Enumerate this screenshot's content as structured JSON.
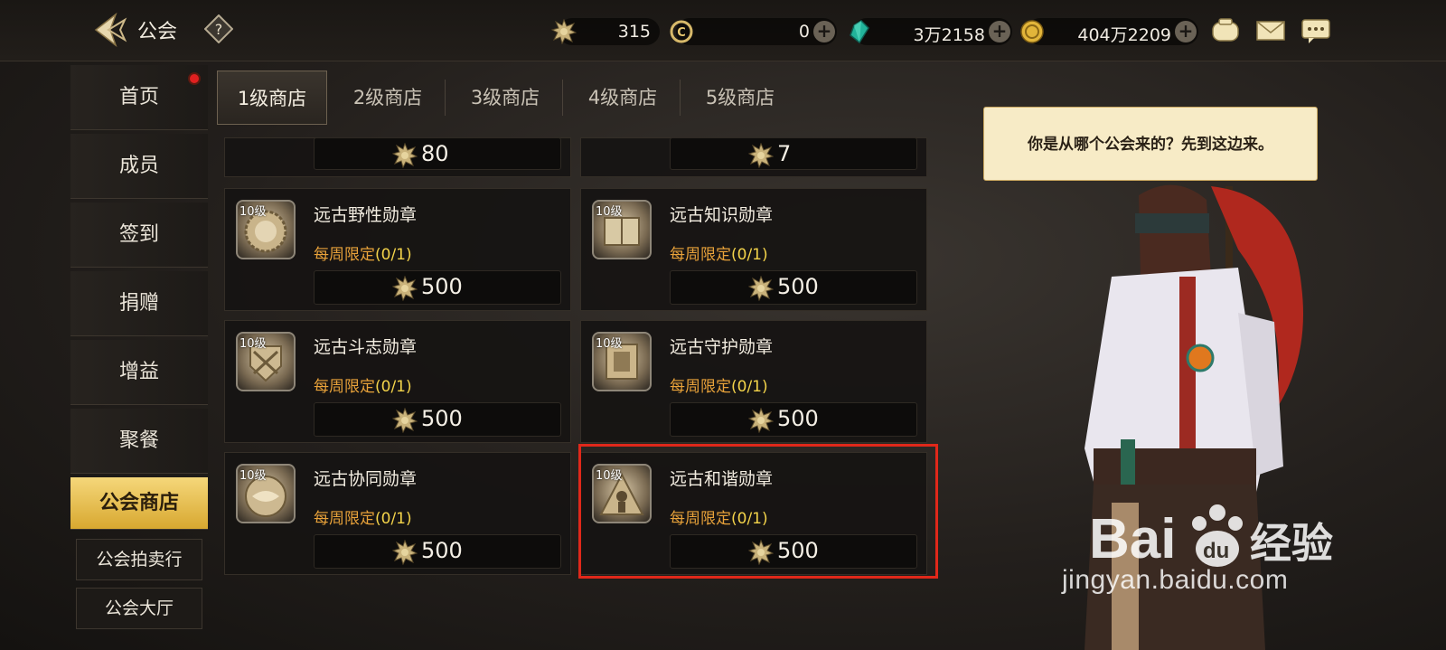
{
  "header": {
    "title": "公会",
    "currencies": [
      {
        "icon": "guild-coin-icon",
        "value": "315",
        "has_plus": false
      },
      {
        "icon": "c-token-icon",
        "value": "0",
        "has_plus": true
      },
      {
        "icon": "crystal-icon",
        "value": "3万2158",
        "has_plus": true
      },
      {
        "icon": "gold-coin-icon",
        "value": "404万2209",
        "has_plus": true
      }
    ],
    "plus_label": "+"
  },
  "sidebar": {
    "items": [
      {
        "label": "首页"
      },
      {
        "label": "成员"
      },
      {
        "label": "签到"
      },
      {
        "label": "捐赠"
      },
      {
        "label": "增益"
      },
      {
        "label": "聚餐"
      },
      {
        "label": "公会商店"
      }
    ],
    "sub_items": [
      {
        "label": "公会拍卖行"
      },
      {
        "label": "公会大厅"
      }
    ],
    "active_index": 6
  },
  "tabs": [
    {
      "label": "1级商店"
    },
    {
      "label": "2级商店"
    },
    {
      "label": "3级商店"
    },
    {
      "label": "4级商店"
    },
    {
      "label": "5级商店"
    }
  ],
  "shop": {
    "partial_prices": [
      "80",
      "7"
    ],
    "items": [
      {
        "level": "10级",
        "name": "远古野性勋章",
        "limit_label": "每周限定",
        "limit_count": "(0/1)",
        "price": "500"
      },
      {
        "level": "10级",
        "name": "远古知识勋章",
        "limit_label": "每周限定",
        "limit_count": "(0/1)",
        "price": "500"
      },
      {
        "level": "10级",
        "name": "远古斗志勋章",
        "limit_label": "每周限定",
        "limit_count": "(0/1)",
        "price": "500"
      },
      {
        "level": "10级",
        "name": "远古守护勋章",
        "limit_label": "每周限定",
        "limit_count": "(0/1)",
        "price": "500"
      },
      {
        "level": "10级",
        "name": "远古协同勋章",
        "limit_label": "每周限定",
        "limit_count": "(0/1)",
        "price": "500"
      },
      {
        "level": "10级",
        "name": "远古和谐勋章",
        "limit_label": "每周限定",
        "limit_count": "(0/1)",
        "price": "500"
      }
    ]
  },
  "npc": {
    "dialog": "你是从哪个公会来的？先到这边来。"
  },
  "watermark": {
    "text": "jingyan.baidu.com"
  },
  "colors": {
    "accent_gold": "#d8a830",
    "limit_orange": "#e8a23a",
    "highlight_red": "#e0281a"
  }
}
